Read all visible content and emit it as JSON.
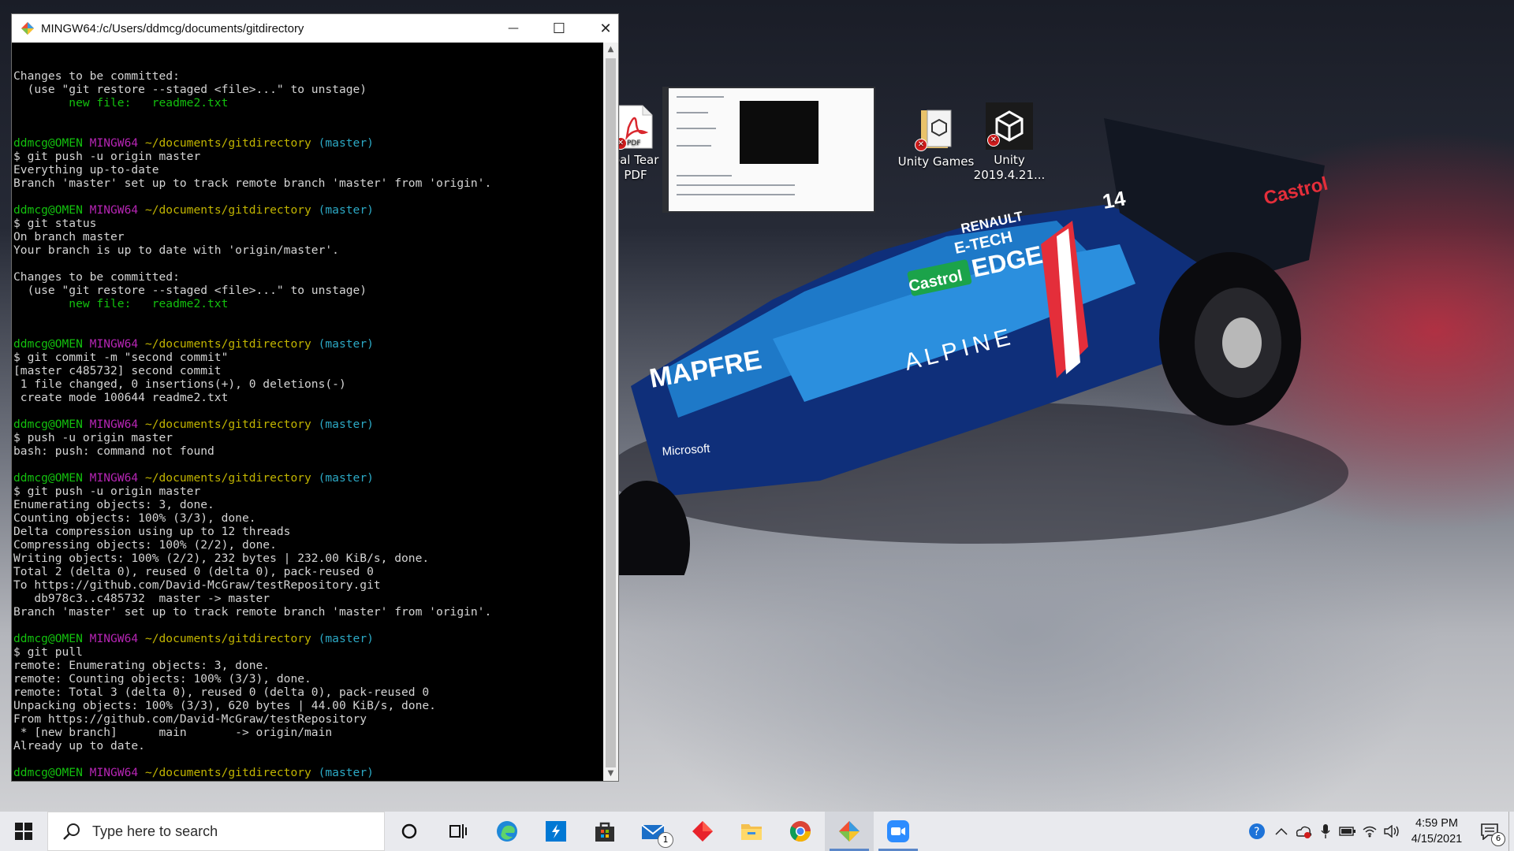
{
  "window": {
    "title": "MINGW64:/c/Users/ddmcg/documents/gitdirectory",
    "minimize": "—",
    "maximize": "☐",
    "close": "✕"
  },
  "terminal_lines": [
    [
      {
        "t": "Changes to be committed:",
        "c": "white"
      }
    ],
    [
      {
        "t": "  (use \"git restore --staged <file>...\" to unstage)",
        "c": "white"
      }
    ],
    [
      {
        "t": "        new file:   readme2.txt",
        "c": "green"
      }
    ],
    [],
    [],
    [
      {
        "t": "ddmcg@OMEN ",
        "c": "green"
      },
      {
        "t": "MINGW64 ",
        "c": "magenta"
      },
      {
        "t": "~/documents/gitdirectory",
        "c": "yellow"
      },
      {
        "t": " (master)",
        "c": "cyan"
      }
    ],
    [
      {
        "t": "$ git push -u origin master",
        "c": "white"
      }
    ],
    [
      {
        "t": "Everything up-to-date",
        "c": "white"
      }
    ],
    [
      {
        "t": "Branch 'master' set up to track remote branch 'master' from 'origin'.",
        "c": "white"
      }
    ],
    [],
    [
      {
        "t": "ddmcg@OMEN ",
        "c": "green"
      },
      {
        "t": "MINGW64 ",
        "c": "magenta"
      },
      {
        "t": "~/documents/gitdirectory",
        "c": "yellow"
      },
      {
        "t": " (master)",
        "c": "cyan"
      }
    ],
    [
      {
        "t": "$ git status",
        "c": "white"
      }
    ],
    [
      {
        "t": "On branch master",
        "c": "white"
      }
    ],
    [
      {
        "t": "Your branch is up to date with 'origin/master'.",
        "c": "white"
      }
    ],
    [],
    [
      {
        "t": "Changes to be committed:",
        "c": "white"
      }
    ],
    [
      {
        "t": "  (use \"git restore --staged <file>...\" to unstage)",
        "c": "white"
      }
    ],
    [
      {
        "t": "        new file:   readme2.txt",
        "c": "green"
      }
    ],
    [],
    [],
    [
      {
        "t": "ddmcg@OMEN ",
        "c": "green"
      },
      {
        "t": "MINGW64 ",
        "c": "magenta"
      },
      {
        "t": "~/documents/gitdirectory",
        "c": "yellow"
      },
      {
        "t": " (master)",
        "c": "cyan"
      }
    ],
    [
      {
        "t": "$ git commit -m \"second commit\"",
        "c": "white"
      }
    ],
    [
      {
        "t": "[master c485732] second commit",
        "c": "white"
      }
    ],
    [
      {
        "t": " 1 file changed, 0 insertions(+), 0 deletions(-)",
        "c": "white"
      }
    ],
    [
      {
        "t": " create mode 100644 readme2.txt",
        "c": "white"
      }
    ],
    [],
    [
      {
        "t": "ddmcg@OMEN ",
        "c": "green"
      },
      {
        "t": "MINGW64 ",
        "c": "magenta"
      },
      {
        "t": "~/documents/gitdirectory",
        "c": "yellow"
      },
      {
        "t": " (master)",
        "c": "cyan"
      }
    ],
    [
      {
        "t": "$ push -u origin master",
        "c": "white"
      }
    ],
    [
      {
        "t": "bash: push: command not found",
        "c": "white"
      }
    ],
    [],
    [
      {
        "t": "ddmcg@OMEN ",
        "c": "green"
      },
      {
        "t": "MINGW64 ",
        "c": "magenta"
      },
      {
        "t": "~/documents/gitdirectory",
        "c": "yellow"
      },
      {
        "t": " (master)",
        "c": "cyan"
      }
    ],
    [
      {
        "t": "$ git push -u origin master",
        "c": "white"
      }
    ],
    [
      {
        "t": "Enumerating objects: 3, done.",
        "c": "white"
      }
    ],
    [
      {
        "t": "Counting objects: 100% (3/3), done.",
        "c": "white"
      }
    ],
    [
      {
        "t": "Delta compression using up to 12 threads",
        "c": "white"
      }
    ],
    [
      {
        "t": "Compressing objects: 100% (2/2), done.",
        "c": "white"
      }
    ],
    [
      {
        "t": "Writing objects: 100% (2/2), 232 bytes | 232.00 KiB/s, done.",
        "c": "white"
      }
    ],
    [
      {
        "t": "Total 2 (delta 0), reused 0 (delta 0), pack-reused 0",
        "c": "white"
      }
    ],
    [
      {
        "t": "To https://github.com/David-McGraw/testRepository.git",
        "c": "white"
      }
    ],
    [
      {
        "t": "   db978c3..c485732  master -> master",
        "c": "white"
      }
    ],
    [
      {
        "t": "Branch 'master' set up to track remote branch 'master' from 'origin'.",
        "c": "white"
      }
    ],
    [],
    [
      {
        "t": "ddmcg@OMEN ",
        "c": "green"
      },
      {
        "t": "MINGW64 ",
        "c": "magenta"
      },
      {
        "t": "~/documents/gitdirectory",
        "c": "yellow"
      },
      {
        "t": " (master)",
        "c": "cyan"
      }
    ],
    [
      {
        "t": "$ git pull",
        "c": "white"
      }
    ],
    [
      {
        "t": "remote: Enumerating objects: 3, done.",
        "c": "white"
      }
    ],
    [
      {
        "t": "remote: Counting objects: 100% (3/3), done.",
        "c": "white"
      }
    ],
    [
      {
        "t": "remote: Total 3 (delta 0), reused 0 (delta 0), pack-reused 0",
        "c": "white"
      }
    ],
    [
      {
        "t": "Unpacking objects: 100% (3/3), 620 bytes | 44.00 KiB/s, done.",
        "c": "white"
      }
    ],
    [
      {
        "t": "From https://github.com/David-McGraw/testRepository",
        "c": "white"
      }
    ],
    [
      {
        "t": " * [new branch]      main       -> origin/main",
        "c": "white"
      }
    ],
    [
      {
        "t": "Already up to date.",
        "c": "white"
      }
    ],
    [],
    [
      {
        "t": "ddmcg@OMEN ",
        "c": "green"
      },
      {
        "t": "MINGW64 ",
        "c": "magenta"
      },
      {
        "t": "~/documents/gitdirectory",
        "c": "yellow"
      },
      {
        "t": " (master)",
        "c": "cyan"
      }
    ],
    [
      {
        "t": "$ ",
        "c": "white"
      }
    ]
  ],
  "desktop": {
    "pdf_label_1": "pal Tear",
    "pdf_label_2": "PDF",
    "unity_games_label": "Unity Games",
    "unity_label_1": "Unity",
    "unity_label_2": "2019.4.21...",
    "pdf_icon_text": "PDF",
    "car_texts": {
      "renault": "RENAULT",
      "etech": "E-TECH",
      "castrol_edge": "EDGE",
      "castrol": "Castrol",
      "mapfre": "MAPFRE",
      "alpine": "ALPINE",
      "microsoft": "Microsoft",
      "number": "14"
    }
  },
  "taskbar": {
    "search_placeholder": "Type here to search",
    "mail_badge": "1",
    "time": "4:59 PM",
    "date": "4/15/2021",
    "notification_count": "6"
  }
}
